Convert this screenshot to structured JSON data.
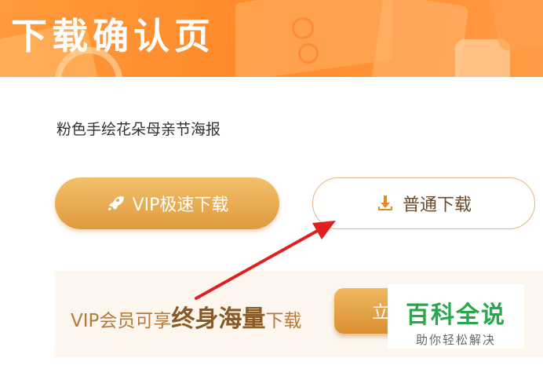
{
  "banner": {
    "title": "下载确认页"
  },
  "file": {
    "name": "粉色手绘花朵母亲节海报"
  },
  "buttons": {
    "vip_label": "VIP极速下载",
    "normal_label": "普通下载"
  },
  "promo": {
    "prefix": "VIP会员可享",
    "highlight": "终身海量",
    "suffix": "下载",
    "button_label": "立"
  },
  "watermark": {
    "title": "百科全说",
    "subtitle": "助你轻松解决"
  },
  "icons": {
    "vip": "rocket-icon",
    "normal": "download-icon"
  },
  "colors": {
    "brand_orange": "#ff8a2a",
    "gold": "#e09a3e",
    "watermark_green": "#27a84a",
    "annotation_red": "#e02020"
  }
}
